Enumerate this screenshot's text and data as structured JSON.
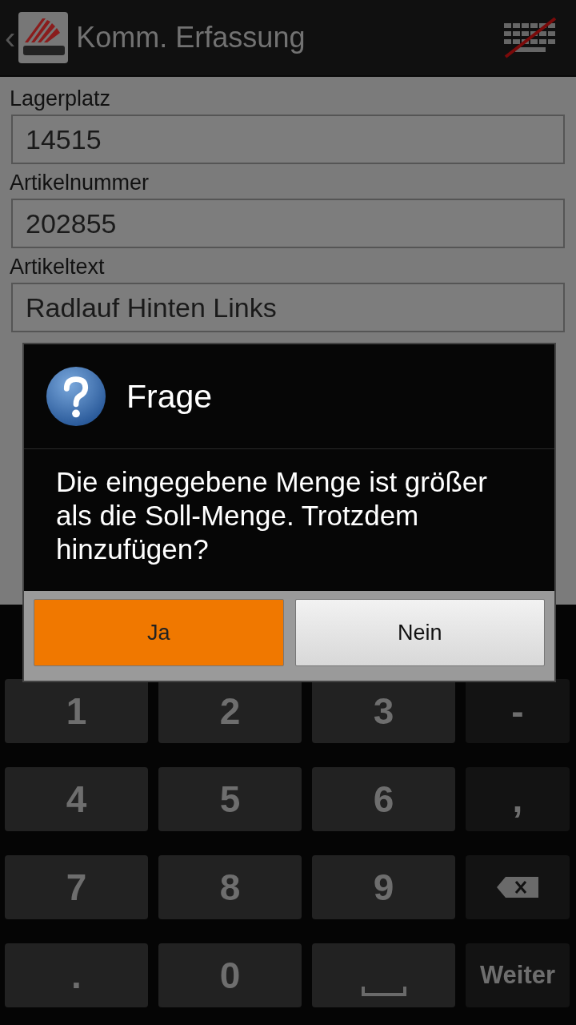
{
  "action_bar": {
    "back": "‹",
    "title": "Komm. Erfassung"
  },
  "form": {
    "fields": [
      {
        "label": "Lagerplatz",
        "value": "14515"
      },
      {
        "label": "Artikelnummer",
        "value": "202855"
      },
      {
        "label": "Artikeltext",
        "value": "Radlauf Hinten Links"
      }
    ]
  },
  "dialog": {
    "title": "Frage",
    "message": "Die eingegebene Menge ist größer als die Soll-Menge. Trotzdem hinzufügen?",
    "buttons": [
      {
        "label": "Ja",
        "kind": "positive"
      },
      {
        "label": "Nein",
        "kind": "negative"
      }
    ]
  },
  "keyboard": [
    {
      "kind": "digit",
      "label": "1"
    },
    {
      "kind": "digit",
      "label": "2"
    },
    {
      "kind": "digit",
      "label": "3"
    },
    {
      "kind": "symbol",
      "label": "-"
    },
    {
      "kind": "digit",
      "label": "4"
    },
    {
      "kind": "digit",
      "label": "5"
    },
    {
      "kind": "digit",
      "label": "6"
    },
    {
      "kind": "symbol",
      "label": ","
    },
    {
      "kind": "digit",
      "label": "7"
    },
    {
      "kind": "digit",
      "label": "8"
    },
    {
      "kind": "digit",
      "label": "9"
    },
    {
      "kind": "backspace"
    },
    {
      "kind": "digit",
      "label": "."
    },
    {
      "kind": "digit",
      "label": "0"
    },
    {
      "kind": "space"
    },
    {
      "kind": "action",
      "label": "Weiter"
    }
  ]
}
